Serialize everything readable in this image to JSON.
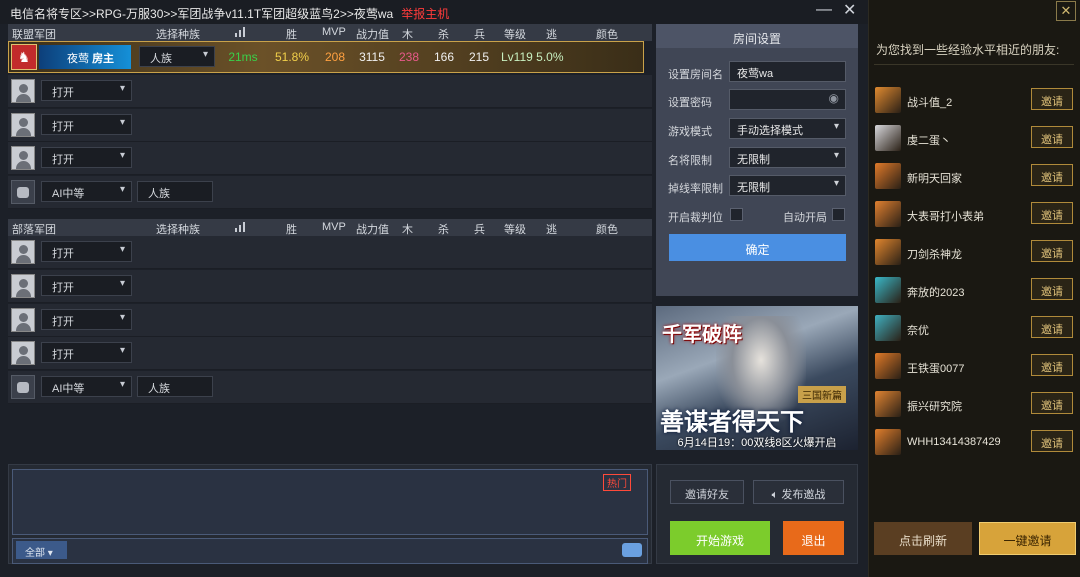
{
  "titlebar": {
    "path": "电信名将专区>>RPG-万服30>>军团战争v11.1T军团超级蓝鸟2>>夜莺wa",
    "report_label": "举报主机",
    "minimize": "—",
    "close": "✕"
  },
  "teams": {
    "alliance": {
      "name": "联盟军团",
      "col_race": "选择种族",
      "col_win": "胜",
      "col_mvp": "MVP",
      "col_power": "战力值",
      "col_wood": "木",
      "col_kill": "杀",
      "col_soldier": "兵",
      "col_level": "等级",
      "col_escape": "逃",
      "col_color": "颜色"
    },
    "horde": {
      "name": "部落军团",
      "col_race": "选择种族",
      "col_win": "胜",
      "col_mvp": "MVP",
      "col_power": "战力值",
      "col_wood": "木",
      "col_kill": "杀",
      "col_soldier": "兵",
      "col_level": "等级",
      "col_escape": "逃",
      "col_color": "颜色"
    }
  },
  "host": {
    "name": "夜莺",
    "role": "房主",
    "race": "人族",
    "ping": "21ms",
    "win_rate": "51.8%",
    "mvp": "208",
    "power": "3115",
    "wood": "238",
    "kill": "166",
    "soldier": "215",
    "level_escape": "Lv119  5.0%"
  },
  "slots": {
    "open": "打开",
    "ai": "AI中等",
    "race": "人族"
  },
  "room": {
    "title": "房间设置",
    "name_label": "设置房间名",
    "name_value": "夜莺wa",
    "pwd_label": "设置密码",
    "mode_label": "游戏模式",
    "mode_value": "手动选择模式",
    "hero_label": "名将限制",
    "hero_value": "无限制",
    "drop_label": "掉线率限制",
    "drop_value": "无限制",
    "judge_label": "开启裁判位",
    "auto_label": "自动开局",
    "confirm": "确定"
  },
  "banner": {
    "logo": "千军破阵",
    "badge": "三国新篇",
    "slogan": "善谋者得天下",
    "date": "6月14日19：00双线8区火爆开启"
  },
  "chat": {
    "hot": "热门",
    "channel": "全部"
  },
  "actions": {
    "invite_friends": "邀请好友",
    "broadcast": "发布邀战",
    "start": "开始游戏",
    "exit": "退出"
  },
  "friends": {
    "title": "为您找到一些经验水平相近的朋友:",
    "invite": "邀请",
    "refresh": "点击刷新",
    "invite_all": "一键邀请",
    "list": [
      {
        "name": "战斗值_2",
        "color": "#e08a30"
      },
      {
        "name": "虔二蛋丶",
        "color": "#d8d8dc"
      },
      {
        "name": "新明天回家",
        "color": "#e07a2a"
      },
      {
        "name": "大表哥打小表弟",
        "color": "#e08030"
      },
      {
        "name": "刀剑杀神龙",
        "color": "#e0862e"
      },
      {
        "name": "奔放的2023",
        "color": "#3ab8c8"
      },
      {
        "name": "奈优",
        "color": "#40b0c0"
      },
      {
        "name": "王铁蛋0077",
        "color": "#e07a28"
      },
      {
        "name": "振兴研究院",
        "color": "#e08432"
      },
      {
        "name": "WHH13414387429",
        "color": "#e07e2c"
      }
    ]
  }
}
